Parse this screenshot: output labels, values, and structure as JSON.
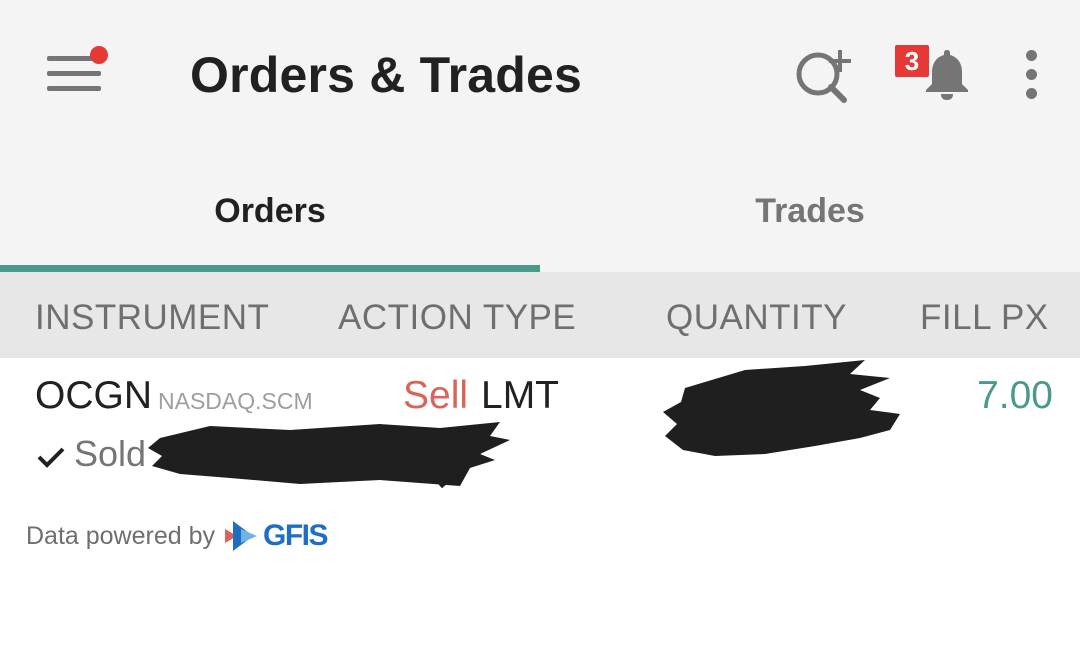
{
  "header": {
    "title": "Orders & Trades",
    "notification_count": "3",
    "icons": [
      "menu-icon",
      "search-add-icon",
      "bell-icon",
      "more-vert-icon"
    ],
    "menu_has_alert": true
  },
  "tabs": [
    {
      "label": "Orders",
      "active": true
    },
    {
      "label": "Trades",
      "active": false
    }
  ],
  "columns": [
    "INSTRUMENT",
    "ACTION TYPE",
    "QUANTITY",
    "FILL PX"
  ],
  "orders": [
    {
      "symbol": "OCGN",
      "exchange": "NASDAQ.SCM",
      "side": "Sell",
      "order_type": "LMT",
      "fill_px": "7.00",
      "status": "Sold"
    }
  ],
  "footer": {
    "powered_by": "Data powered by",
    "brand": "GFIS"
  },
  "colors": {
    "accent": "#4a9a8c",
    "sell": "#d9645a",
    "alert": "#e53935",
    "brand": "#1e6fc1"
  }
}
